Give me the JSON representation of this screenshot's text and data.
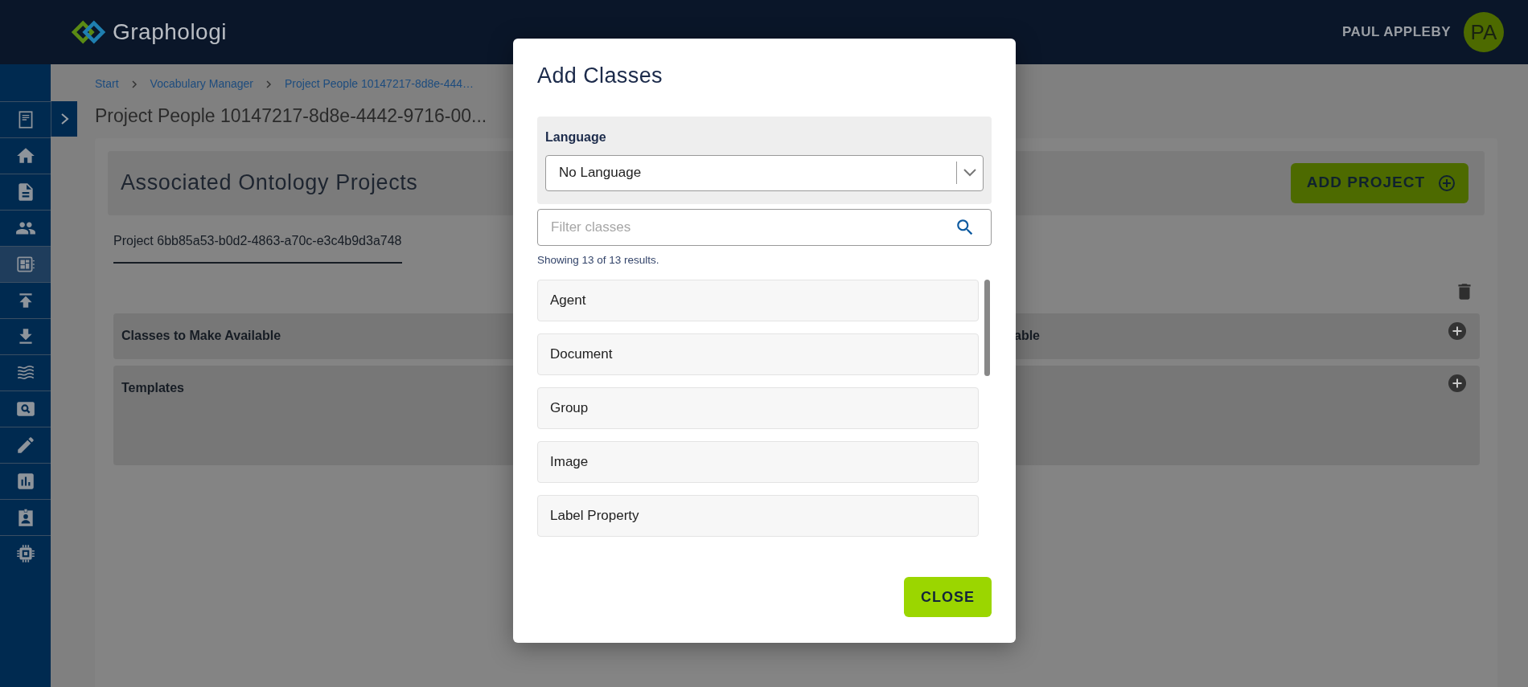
{
  "header": {
    "logo_text": "Graphologi",
    "user_name": "PAUL APPLEBY",
    "avatar_initials": "PA"
  },
  "sidebar": {
    "items": [
      {
        "selected": false
      },
      {
        "selected": false
      },
      {
        "selected": false
      },
      {
        "selected": false
      },
      {
        "selected": true
      },
      {
        "selected": false
      },
      {
        "selected": false
      },
      {
        "selected": false
      },
      {
        "selected": false
      },
      {
        "selected": false
      },
      {
        "selected": false
      },
      {
        "selected": false
      },
      {
        "selected": false
      }
    ]
  },
  "breadcrumb": [
    "Start",
    "Vocabulary Manager",
    "Project People 10147217-8d8e-444…"
  ],
  "page_title": "Project People 10147217-8d8e-4442-9716-00...",
  "section": {
    "title": "Associated Ontology Projects",
    "add_button": "ADD PROJECT"
  },
  "tabs": [
    {
      "label": "Project 6bb85a53-b0d2-4863-a70c-e3c4b9d3a748",
      "selected": true
    }
  ],
  "panels": [
    {
      "left": "Classes to Make Available",
      "right": "able"
    },
    {
      "left": "Templates"
    }
  ],
  "modal": {
    "title": "Add Classes",
    "language": {
      "label": "Language",
      "value": "No Language"
    },
    "filter": {
      "placeholder": "Filter classes"
    },
    "results_text": "Showing 13 of 13 results.",
    "classes": [
      "Agent",
      "Document",
      "Group",
      "Image",
      "Label Property"
    ],
    "close_button": "CLOSE"
  }
}
